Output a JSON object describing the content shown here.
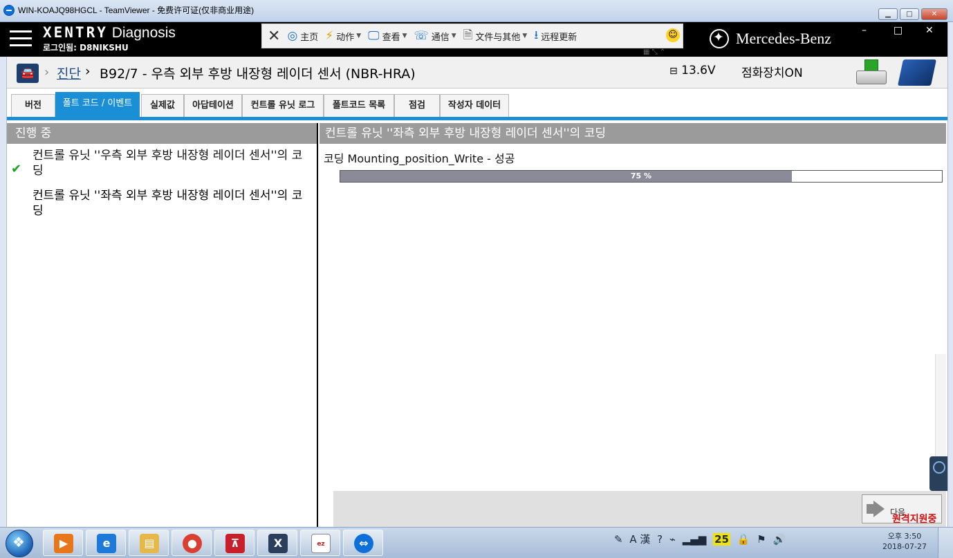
{
  "teamviewer": {
    "window_title": "WIN-KOAJQ98HGCL - TeamViewer - 免费许可证(仅非商业用途)",
    "minimize": "▁",
    "maximize": "□",
    "close": "✕",
    "toolbar": {
      "home": "主页",
      "actions": "动作",
      "view": "查看",
      "communicate": "通信",
      "files": "文件与其他",
      "remote_update": "远程更新"
    },
    "remote_support_label": "원격지원중"
  },
  "xentry": {
    "brand_bold": "XENTRY",
    "brand_light": "Diagnosis",
    "login": "로그인됨: D8NIKSHU",
    "mb_name": "Mercedes-Benz",
    "min": "–",
    "max": "□",
    "close": "✕"
  },
  "breadcrumb": {
    "link": "진단",
    "title": "B92/7 - 우측 외부 후방 내장형 레이더 센서 (NBR-HRA)",
    "battery": "13.6V",
    "ignition": "점화장치ON"
  },
  "tabs": [
    {
      "label": "버전"
    },
    {
      "label": "폴트 코드 / 이벤트"
    },
    {
      "label": "실제값"
    },
    {
      "label": "아답테이션"
    },
    {
      "label": "컨트롤 유닛 로그"
    },
    {
      "label": "폴트코드 목록"
    },
    {
      "label": "점검"
    },
    {
      "label": "작성자 데이터"
    }
  ],
  "left_panel": {
    "header": "진행 중",
    "steps": [
      {
        "text": "컨트롤 유닛 ''우측 외부 후방 내장형 레이더 센서''의 코딩",
        "done": true
      },
      {
        "text": "컨트롤 유닛 ''좌측 외부 후방 내장형 레이더 센서''의 코딩",
        "done": false
      }
    ]
  },
  "right_panel": {
    "header": "컨트롤 유닛 ''좌측 외부 후방 내장형 레이더 센서''의 코딩",
    "status": "코딩 Mounting_position_Write  - 성공",
    "progress_percent": 75,
    "progress_label": "75 %",
    "next_label": "다음"
  },
  "taskbar": {
    "tray_ime": "A 漢",
    "tray_number": "25",
    "clock_time": "오후 3:50",
    "clock_date": "2018-07-27"
  },
  "colors": {
    "accent_blue": "#1b8fd6",
    "panel_header_gray": "#9b9b9b",
    "progress_fill": "#8a8a99",
    "success_green": "#1aa31a",
    "remote_red": "#d01010"
  }
}
